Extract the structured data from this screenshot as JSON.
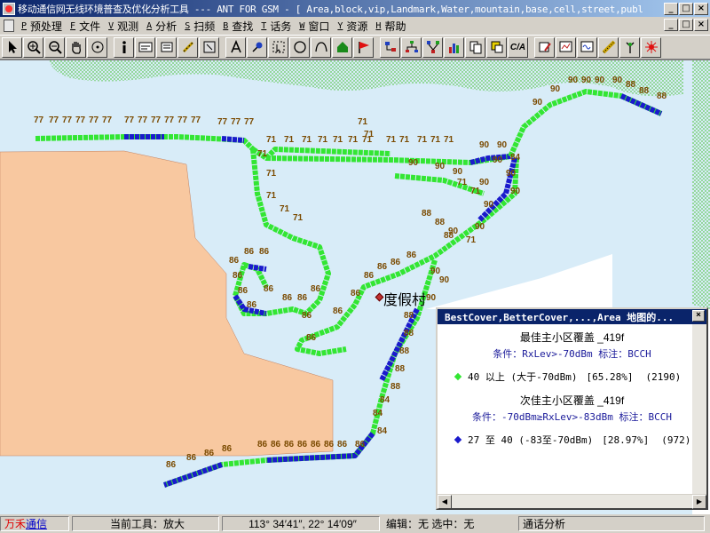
{
  "window": {
    "title": "移动通信网无线环境普查及优化分析工具 --- ANT FOR GSM - [  Area,block,vip,Landmark,Water,mountain,base,cell,street,publ",
    "min_label": "_",
    "max_label": "□",
    "close_label": "×"
  },
  "menu": {
    "items": [
      {
        "key": "P",
        "label": "预处理"
      },
      {
        "key": "F",
        "label": "文件"
      },
      {
        "key": "V",
        "label": "观测"
      },
      {
        "key": "A",
        "label": "分析"
      },
      {
        "key": "S",
        "label": "扫频"
      },
      {
        "key": "B",
        "label": "查找"
      },
      {
        "key": "T",
        "label": "话务"
      },
      {
        "key": "W",
        "label": "窗口"
      },
      {
        "key": "Y",
        "label": "资源"
      },
      {
        "key": "H",
        "label": "帮助"
      }
    ]
  },
  "toolbar": {
    "tools": [
      "pointer-icon",
      "zoom-in-icon",
      "zoom-out-icon",
      "pan-hand-icon",
      "center-icon",
      "info-icon",
      "label-icon",
      "ruler-icon",
      "layer-icon",
      "text-icon",
      "pin-icon",
      "select-icon",
      "circle-icon",
      "polygon-icon",
      "house-icon",
      "flag-icon"
    ],
    "tools2": [
      "graph-icon",
      "tree-icon",
      "network-icon",
      "bar-chart-icon",
      "copy-icon",
      "paste-icon",
      "ca-icon",
      "pen-icon",
      "report-icon",
      "wave-icon",
      "measure-icon",
      "antenna-icon",
      "star-icon"
    ],
    "ca_label": "C/A"
  },
  "map": {
    "poi_label": "度假村",
    "colors": {
      "water": "#d8ecf8",
      "land": "#f8c8a0",
      "island": "#ffffff",
      "strong": "#33e633",
      "weak": "#1a1acc",
      "label": "#7a4a00"
    },
    "route_labels": {
      "77": "77",
      "71": "71",
      "90": "90",
      "88": "88",
      "84": "84",
      "86": "86"
    }
  },
  "legend": {
    "title": "BestCover,BetterCover,...,Area 地图的...",
    "close_label": "×",
    "section1": {
      "title": "最佳主小区覆盖 _419f",
      "condition": "条件：RxLev>-70dBm  标注：BCCH",
      "range": "40 以上 (大于-70dBm)",
      "percent": "[65.28%]",
      "count": "(2190)",
      "color": "#33e633"
    },
    "section2": {
      "title": "次佳主小区覆盖 _419f",
      "condition": "条件：-70dBm≥RxLev>-83dBm  标注：BCCH",
      "range": "27 至 40 (-83至-70dBm)",
      "percent": "[28.97%]",
      "count": "(972)",
      "color": "#1a1acc"
    }
  },
  "status": {
    "brand": "万禾",
    "brand_link": "通信",
    "tool": "当前工具：放大",
    "coords": "113° 34′41″, 22° 14′09″",
    "edit": "编辑：无 选中：无",
    "mode": "通话分析"
  }
}
